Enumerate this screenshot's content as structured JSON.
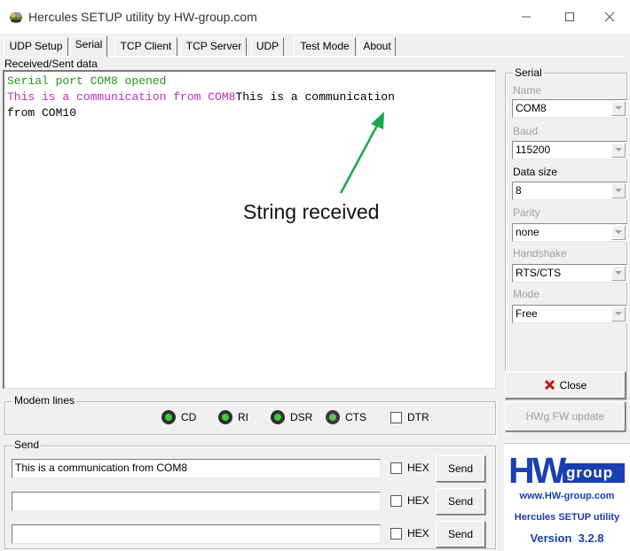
{
  "window": {
    "title": "Hercules SETUP utility by HW-group.com"
  },
  "tabs": [
    "UDP Setup",
    "Serial",
    "TCP Client",
    "TCP Server",
    "UDP",
    "Test Mode",
    "About"
  ],
  "received": {
    "label": "Received/Sent data",
    "line1": "Serial port COM8 opened",
    "line2_magenta": "This is a communication from COM8",
    "line2_black": "This is a communication",
    "line3": "from COM10"
  },
  "annotation": {
    "text": "String received",
    "arrow_color": "#1aa84a"
  },
  "serial": {
    "group_label": "Serial",
    "name_label": "Name",
    "name_value": "COM8",
    "baud_label": "Baud",
    "baud_value": "115200",
    "datasize_label": "Data size",
    "datasize_value": "8",
    "parity_label": "Parity",
    "parity_value": "none",
    "handshake_label": "Handshake",
    "handshake_value": "RTS/CTS",
    "mode_label": "Mode",
    "mode_value": "Free",
    "close_label": "Close",
    "fw_update_label": "HWg FW update"
  },
  "modem": {
    "label": "Modem lines",
    "cd": "CD",
    "ri": "RI",
    "dsr": "DSR",
    "cts": "CTS",
    "dtr": "DTR"
  },
  "send": {
    "label": "Send",
    "rows": [
      {
        "value": "This is a communication from COM8",
        "hex": "HEX",
        "button": "Send"
      },
      {
        "value": "",
        "hex": "HEX",
        "button": "Send"
      },
      {
        "value": "",
        "hex": "HEX",
        "button": "Send"
      }
    ]
  },
  "logo": {
    "brand": "group",
    "url": "www.HW-group.com",
    "product": "Hercules SETUP utility",
    "version": "Version  3.2.8"
  },
  "colors": {
    "green_text": "#1a9b1a",
    "magenta_text": "#c02bc0",
    "logo_blue": "#1a3fb0",
    "close_red": "#cc1111"
  }
}
